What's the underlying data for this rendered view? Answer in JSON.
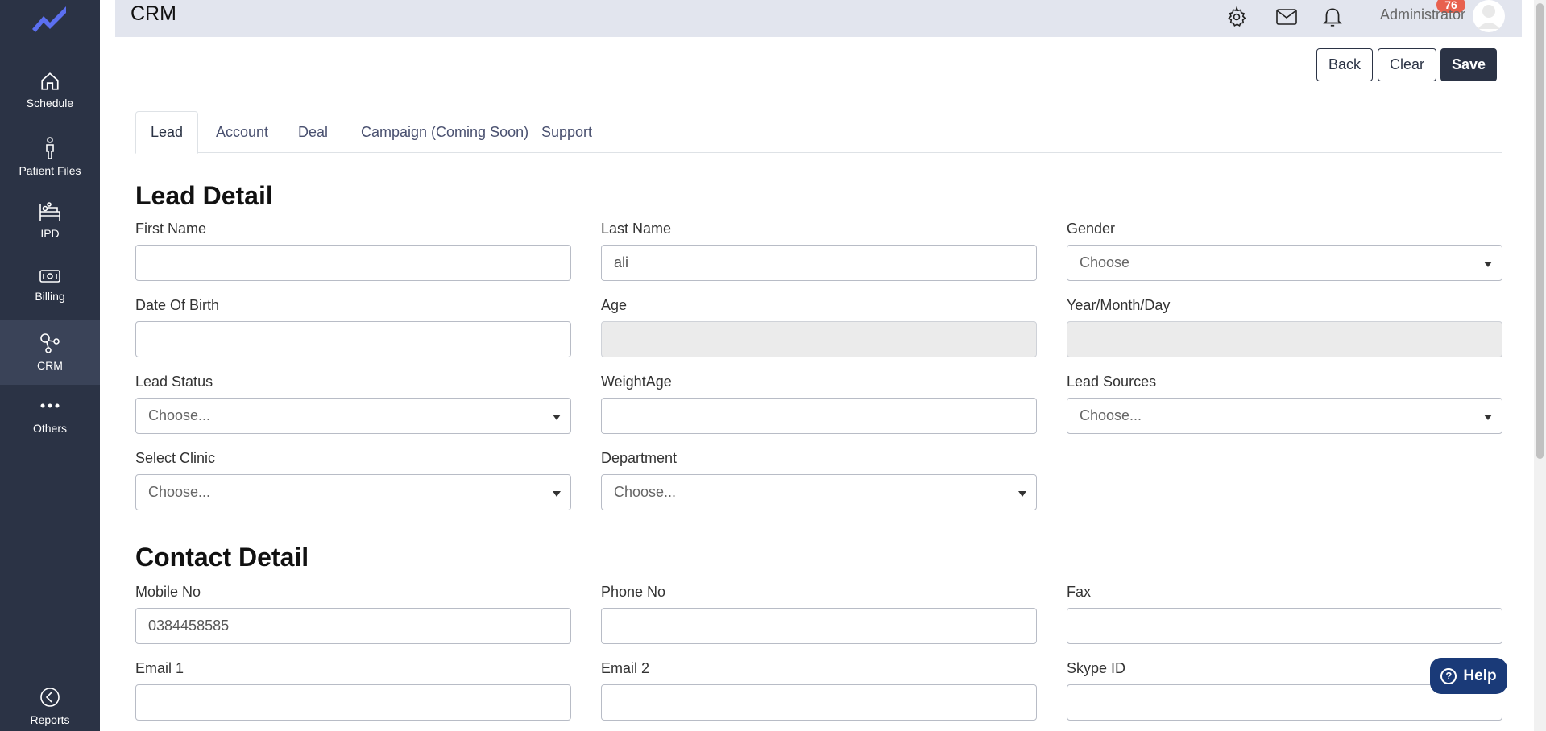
{
  "sidebar": {
    "items": [
      {
        "label": "Schedule"
      },
      {
        "label": "Patient Files"
      },
      {
        "label": "IPD"
      },
      {
        "label": "Billing"
      },
      {
        "label": "CRM"
      },
      {
        "label": "Others"
      },
      {
        "label": "Reports"
      }
    ],
    "active": "CRM"
  },
  "header": {
    "title": "CRM",
    "notification_count": "76",
    "user_name": "Administrator"
  },
  "actions": {
    "back": "Back",
    "clear": "Clear",
    "save": "Save"
  },
  "tabs": [
    {
      "label": "Lead"
    },
    {
      "label": "Account"
    },
    {
      "label": "Deal"
    },
    {
      "label": "Campaign (Coming Soon)"
    },
    {
      "label": "Support"
    }
  ],
  "lead_detail": {
    "title": "Lead Detail",
    "first_name": {
      "label": "First Name",
      "value": ""
    },
    "last_name": {
      "label": "Last Name",
      "value": "ali"
    },
    "gender": {
      "label": "Gender",
      "value": "Choose"
    },
    "dob": {
      "label": "Date Of Birth",
      "value": ""
    },
    "age": {
      "label": "Age",
      "value": ""
    },
    "ymd": {
      "label": "Year/Month/Day",
      "value": ""
    },
    "lead_status": {
      "label": "Lead Status",
      "value": "Choose..."
    },
    "weightage": {
      "label": "WeightAge",
      "value": ""
    },
    "lead_sources": {
      "label": "Lead Sources",
      "value": "Choose..."
    },
    "clinic": {
      "label": "Select Clinic",
      "value": "Choose..."
    },
    "department": {
      "label": "Department",
      "value": "Choose..."
    }
  },
  "contact_detail": {
    "title": "Contact Detail",
    "mobile": {
      "label": "Mobile No",
      "value": "0384458585"
    },
    "phone": {
      "label": "Phone No",
      "value": ""
    },
    "fax": {
      "label": "Fax",
      "value": ""
    },
    "email1": {
      "label": "Email 1",
      "value": ""
    },
    "email2": {
      "label": "Email 2",
      "value": ""
    },
    "skype": {
      "label": "Skype ID",
      "value": ""
    }
  },
  "help": {
    "label": "Help"
  },
  "colors": {
    "sidebar_bg": "#2b3345",
    "header_bg": "#e2e5ee",
    "badge": "#e8614e",
    "help_bg": "#1a3a78"
  }
}
